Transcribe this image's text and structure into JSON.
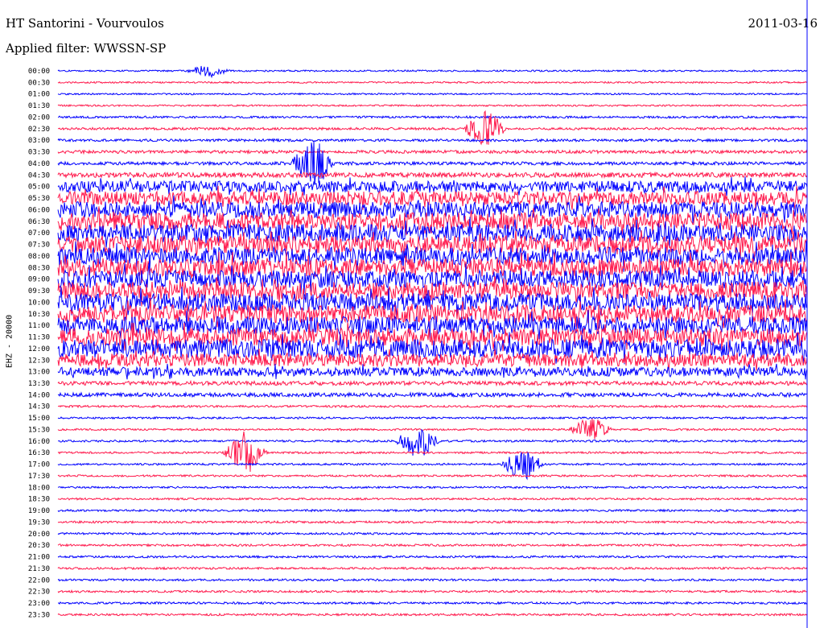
{
  "chart_data": {
    "type": "line",
    "title": "HT Santorini - Vourvoulos",
    "subtitle": "Applied filter: WWSSN-SP",
    "date": "2011-03-16",
    "ylabel": "EHZ - 20000",
    "xlabel": "",
    "y_tick_labels": [
      "00:00",
      "00:30",
      "01:00",
      "01:30",
      "02:00",
      "02:30",
      "03:00",
      "03:30",
      "04:00",
      "04:30",
      "05:00",
      "05:30",
      "06:00",
      "06:30",
      "07:00",
      "07:30",
      "08:00",
      "08:30",
      "09:00",
      "09:30",
      "10:00",
      "10:30",
      "11:00",
      "11:30",
      "12:00",
      "12:30",
      "13:00",
      "13:30",
      "14:00",
      "14:30",
      "15:00",
      "15:30",
      "16:00",
      "16:30",
      "17:00",
      "17:30",
      "18:00",
      "18:30",
      "19:00",
      "19:30",
      "20:00",
      "20:30",
      "21:00",
      "21:30",
      "22:00",
      "22:30",
      "23:00",
      "23:30"
    ],
    "series_colors": [
      "#0000ff",
      "#ff1a4d"
    ],
    "trace_amplitude": [
      1,
      1,
      1,
      1,
      1.3,
      1.5,
      1.6,
      1.9,
      2,
      3,
      7,
      8.5,
      10,
      10.5,
      11,
      11,
      11,
      11,
      11,
      11,
      11,
      11,
      11,
      11,
      11.5,
      8,
      5.5,
      2.5,
      2.5,
      1.3,
      1.2,
      1.2,
      1.3,
      1.2,
      1.2,
      1.2,
      1.2,
      1.2,
      1.3,
      1.3,
      1.3,
      1.3,
      1.3,
      1.3,
      1.3,
      1.3,
      1.3,
      1.3
    ],
    "events": [
      {
        "time": "00:00",
        "amplitude": 8
      },
      {
        "time": "02:30",
        "amplitude": 25
      },
      {
        "time": "04:00",
        "amplitude": 35
      },
      {
        "time": "15:30",
        "amplitude": 18
      },
      {
        "time": "16:00",
        "amplitude": 24
      },
      {
        "time": "16:30",
        "amplitude": 30
      },
      {
        "time": "17:00",
        "amplitude": 22
      }
    ],
    "grid": false,
    "legend": "none"
  }
}
